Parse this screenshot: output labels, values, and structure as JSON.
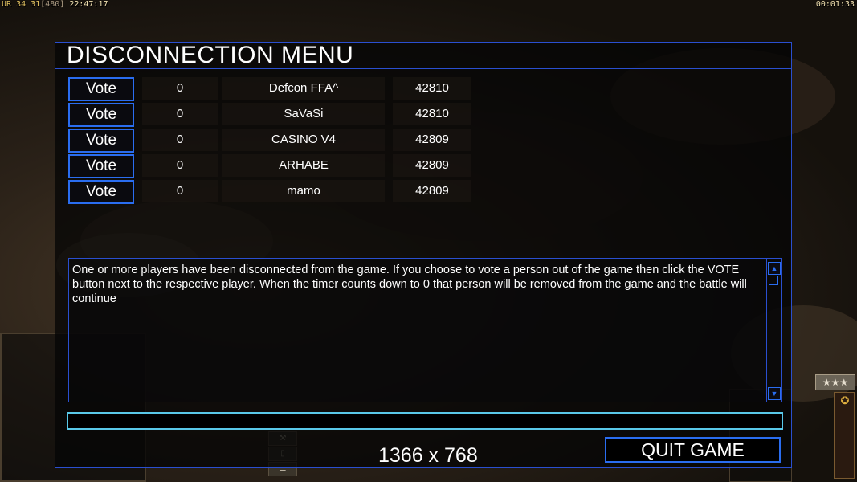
{
  "hud": {
    "left_prefix": "UR",
    "left_values": "34 31",
    "left_bracket": "[480]",
    "clock": "22:47:17",
    "timer": "00:01:33"
  },
  "panel": {
    "title": "DISCONNECTION MENU"
  },
  "players": [
    {
      "vote_label": "Vote",
      "count": "0",
      "name": "Defcon FFA^",
      "ping": "42810"
    },
    {
      "vote_label": "Vote",
      "count": "0",
      "name": "SaVaSi",
      "ping": "42810"
    },
    {
      "vote_label": "Vote",
      "count": "0",
      "name": "CASINO V4",
      "ping": "42809"
    },
    {
      "vote_label": "Vote",
      "count": "0",
      "name": "ARHABE",
      "ping": "42809"
    },
    {
      "vote_label": "Vote",
      "count": "0",
      "name": "mamo",
      "ping": "42809"
    }
  ],
  "message": "One or more players have been disconnected from the game. If you choose to vote a person out of the game then click the VOTE button next to the respective player. When the timer counts down to 0 that person will be removed from the game and the battle will continue",
  "resolution": "1366 x 768",
  "quit_label": "QUIT GAME",
  "rank_stars": "★★★",
  "colors": {
    "panel_border": "#2a4fd0",
    "button_border": "#2a6df0",
    "chat_border": "#59c8e8",
    "text": "#ffffff"
  }
}
